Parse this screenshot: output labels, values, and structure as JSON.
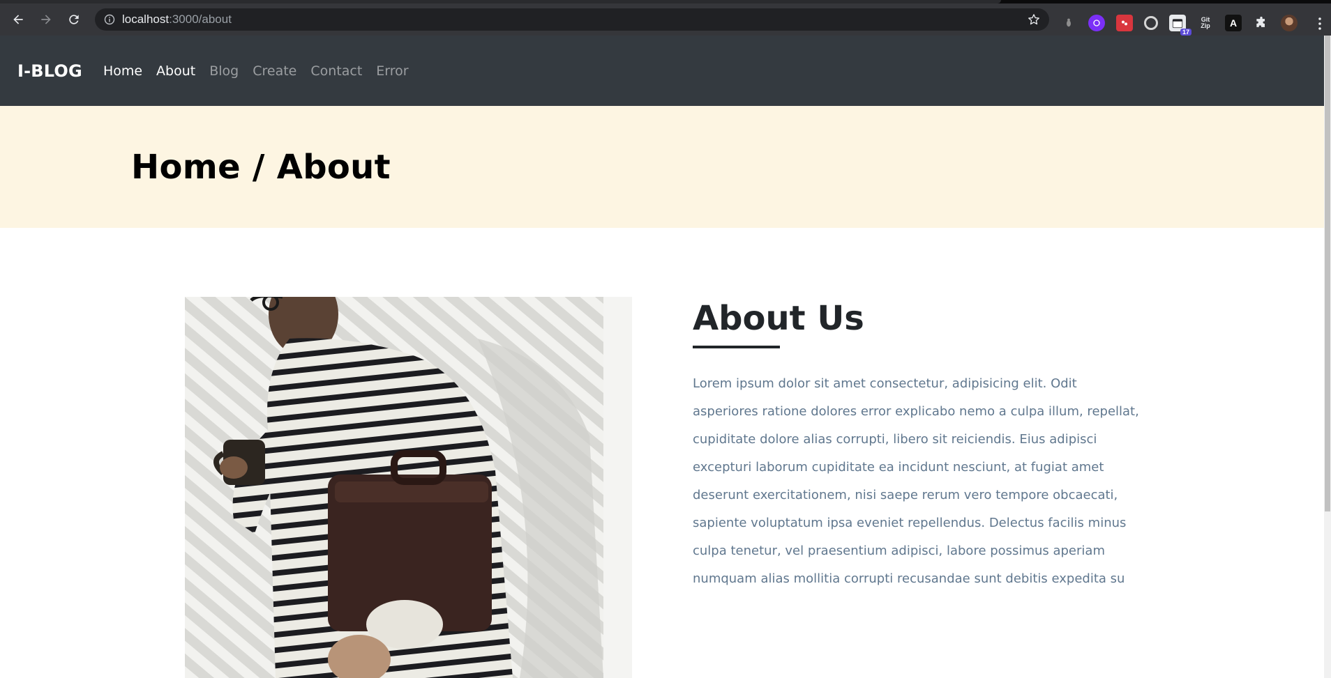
{
  "browser": {
    "url_host": "localhost",
    "url_path": ":3000/about",
    "extensions": [
      {
        "name": "bug-icon"
      },
      {
        "name": "purple-ext-icon"
      },
      {
        "name": "red-ext-icon"
      },
      {
        "name": "target-icon"
      },
      {
        "name": "calendar-icon",
        "badge": "17"
      },
      {
        "name": "gitzip-icon",
        "line1": "Git",
        "line2": "Zip"
      },
      {
        "name": "a-ext-icon",
        "label": "A"
      },
      {
        "name": "puzzle-icon"
      },
      {
        "name": "avatar"
      }
    ]
  },
  "navbar": {
    "brand": "I-BLOG",
    "links": [
      {
        "label": "Home",
        "active": true
      },
      {
        "label": "About",
        "active": true
      },
      {
        "label": "Blog",
        "active": false
      },
      {
        "label": "Create",
        "active": false
      },
      {
        "label": "Contact",
        "active": false
      },
      {
        "label": "Error",
        "active": false
      }
    ]
  },
  "banner": {
    "title": "Home / About"
  },
  "about": {
    "heading": "About Us",
    "body": "Lorem ipsum dolor sit amet consectetur, adipisicing elit. Odit asperiores ratione dolores error explicabo nemo a culpa illum, repellat, cupiditate dolore alias corrupti, libero sit reiciendis. Eius adipisci excepturi laborum cupiditate ea incidunt nesciunt, at fugiat amet deserunt exercitationem, nisi saepe rerum vero tempore obcaecati, sapiente voluptatum ipsa eveniet repellendus. Delectus facilis minus culpa tenetur, vel praesentium adipisci, labore possimus aperiam numquam alias mollitia corrupti recusandae sunt debitis expedita su"
  },
  "colors": {
    "navbar_bg": "#343a40",
    "banner_bg": "#fdf5e2",
    "body_text": "#60778e",
    "heading_text": "#212529"
  }
}
